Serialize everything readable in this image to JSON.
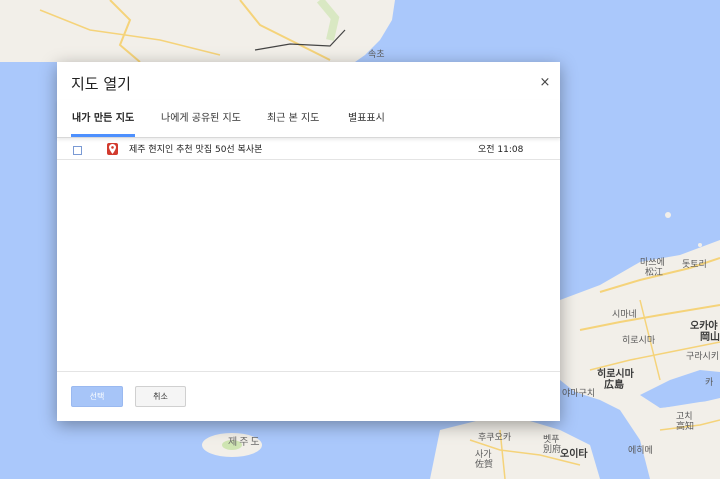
{
  "dialog": {
    "title": "지도 열기",
    "close_glyph": "×",
    "tabs": [
      {
        "label": "내가 만든 지도",
        "active": true
      },
      {
        "label": "나에게 공유된 지도",
        "active": false
      },
      {
        "label": "최근 본 지도",
        "active": false
      },
      {
        "label": "별표표시",
        "active": false
      }
    ],
    "rows": [
      {
        "title": "제주 현지인 추천 맛집 50선 복사본",
        "time": "오전 11:08",
        "icon": "map-pin-icon",
        "checked": false
      }
    ],
    "buttons": {
      "select": "선택",
      "cancel": "취소"
    }
  },
  "map": {
    "labels": {
      "sokcho": "속초",
      "jeju": "제주도",
      "matsue": "마쓰에",
      "matsue_kanji": "松江",
      "tottori": "돗토리",
      "shimane": "시마네",
      "okayama": "오카야",
      "okayama_kanji": "岡山",
      "hiroshima_ko": "히로시마",
      "hiroshima": "히로시마",
      "hiroshima_kanji": "広島",
      "kurashiki": "구라시키",
      "yamaguchi": "야마구치",
      "kochi": "고치",
      "kochi_kanji": "高知",
      "ehime": "에히메",
      "fukuoka": "후쿠오카",
      "beppu": "벳푸",
      "beppu_kanji": "別府",
      "saga": "사가",
      "saga_kanji": "佐賀",
      "oita": "오이타",
      "kagawa": "카가",
      "ka": "카"
    },
    "colors": {
      "water": "#aac8fb",
      "land": "#f2efe9",
      "road": "#f5d37a",
      "park": "#cfe5b2"
    }
  }
}
